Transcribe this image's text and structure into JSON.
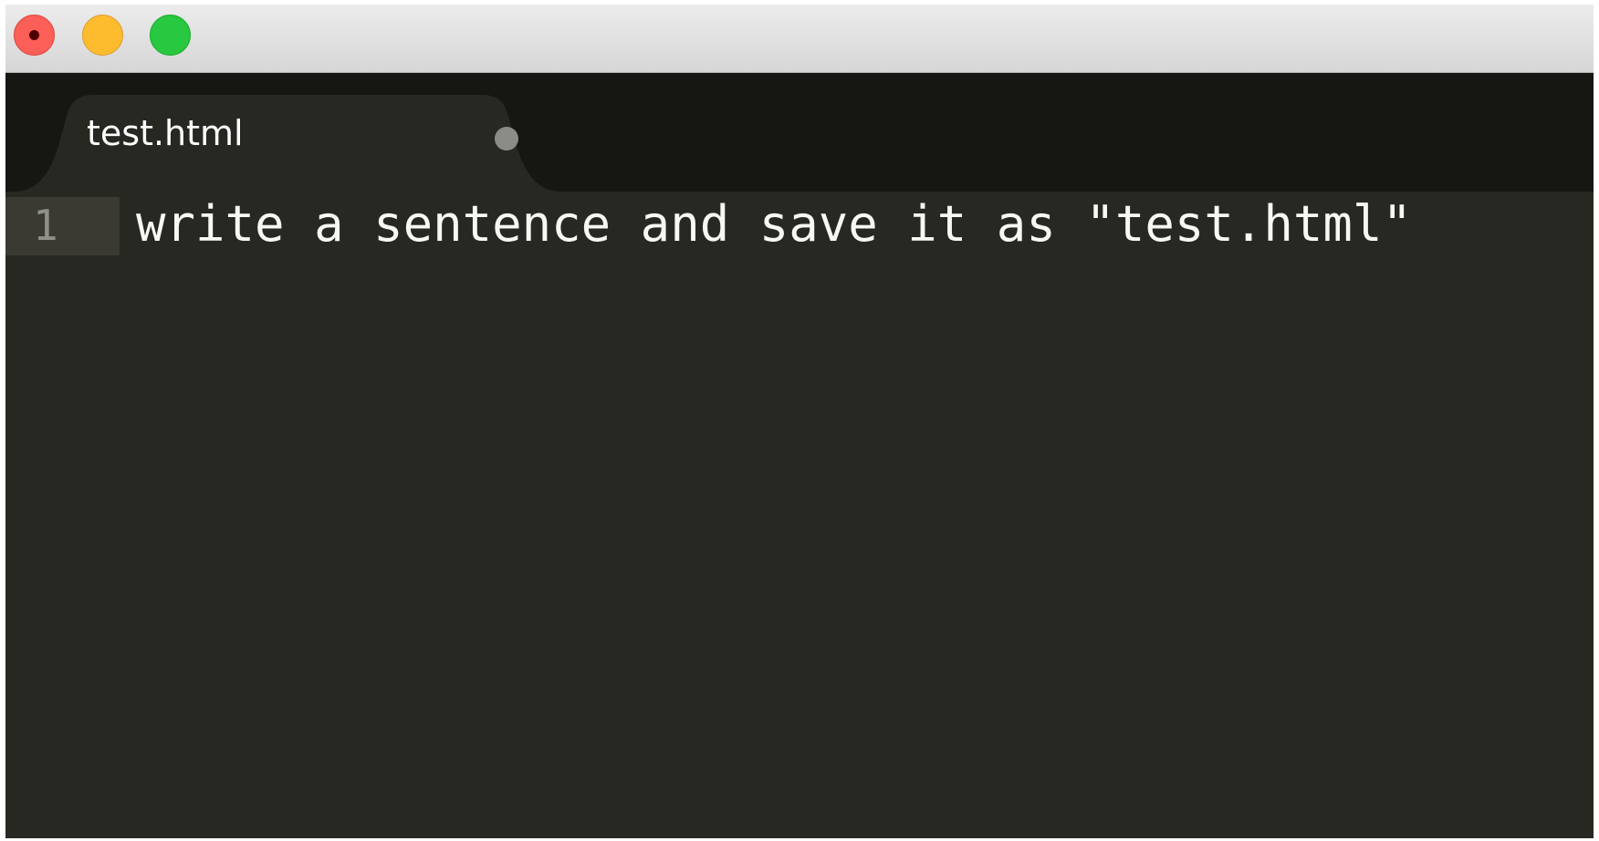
{
  "window": {
    "controls": [
      "close",
      "minimize",
      "zoom"
    ]
  },
  "tabs": [
    {
      "label": "test.html",
      "active": true,
      "unsaved": true
    }
  ],
  "editor": {
    "lines": [
      {
        "number": "1",
        "text": "write a sentence and save it as \"test.html\""
      }
    ]
  },
  "colors": {
    "editor_background": "#272822",
    "tabbar_background": "#161713",
    "active_tab": "#272822",
    "text": "#f8f8f2",
    "line_number": "#8f908a",
    "close_button": "#fc5f57",
    "minimize_button": "#fdbc2e",
    "zoom_button": "#28c840"
  }
}
